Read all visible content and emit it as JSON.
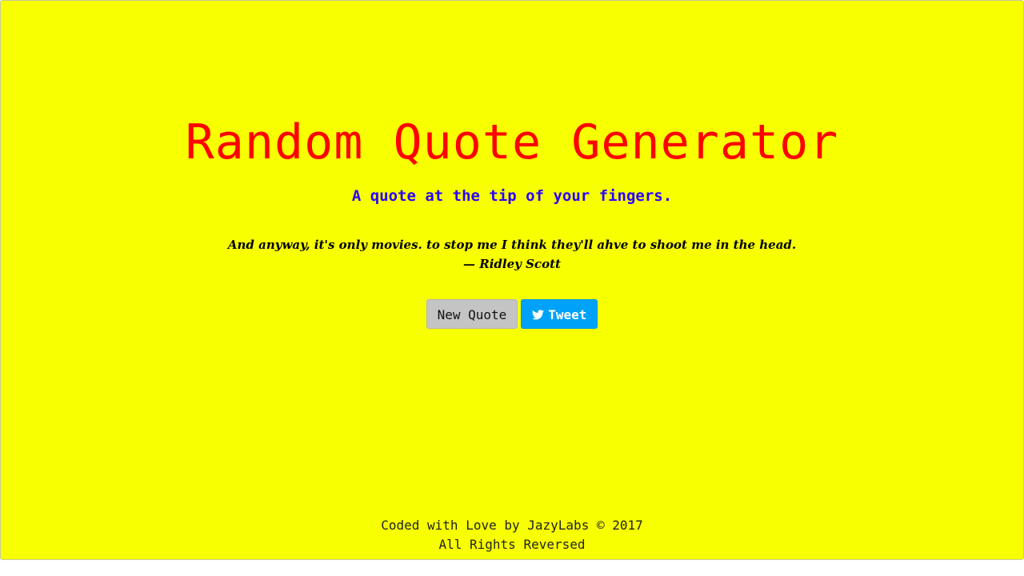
{
  "header": {
    "title": "Random Quote Generator",
    "subtitle": "A quote at the tip of your fingers."
  },
  "quote": {
    "text": "And anyway, it's only movies. to stop me I think they'll ahve to shoot me in the head.",
    "author": "— Ridley Scott"
  },
  "actions": {
    "new_quote_label": "New Quote",
    "tweet_label": "Tweet",
    "tweet_icon": "twitter-bird-icon"
  },
  "footer": {
    "line1": "Coded with Love by JazyLabs © 2017",
    "line2": "All Rights Reversed"
  },
  "colors": {
    "background": "#f7ff00",
    "title": "#ff0000",
    "subtitle": "#2b00ff",
    "tweet_button": "#00a2f8",
    "new_quote_button": "#c4c4c4"
  }
}
